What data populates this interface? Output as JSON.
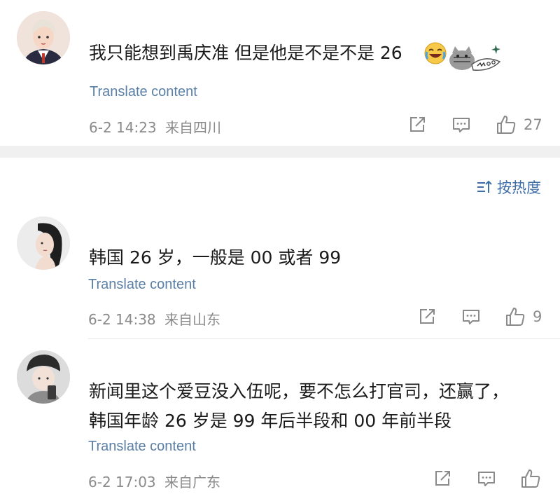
{
  "comments": [
    {
      "text_lines": [
        "我只能想到禹庆准 但是他是不是不是 26"
      ],
      "translate_label": "Translate content",
      "date": "6-2 14:23",
      "location": "来自四川",
      "likes": "27",
      "emoji": "meow"
    },
    {
      "text_lines": [
        "韩国 26 岁，一般是 00 或者 99"
      ],
      "translate_label": "Translate content",
      "date": "6-2 14:38",
      "location": "来自山东",
      "likes": "9"
    },
    {
      "text_lines": [
        "新闻里这个爱豆没入伍呢，要不怎么打官司，还赢了，",
        "韩国年龄 26 岁是 99 年后半段和 00 年前半段"
      ],
      "translate_label": "Translate content",
      "date": "6-2 17:03",
      "location": "来自广东",
      "likes": ""
    }
  ],
  "sort": {
    "label": "按热度"
  },
  "colors": {
    "link": "#5a7fa6",
    "sort": "#3e6ea8",
    "meta": "#8a8a8a"
  }
}
